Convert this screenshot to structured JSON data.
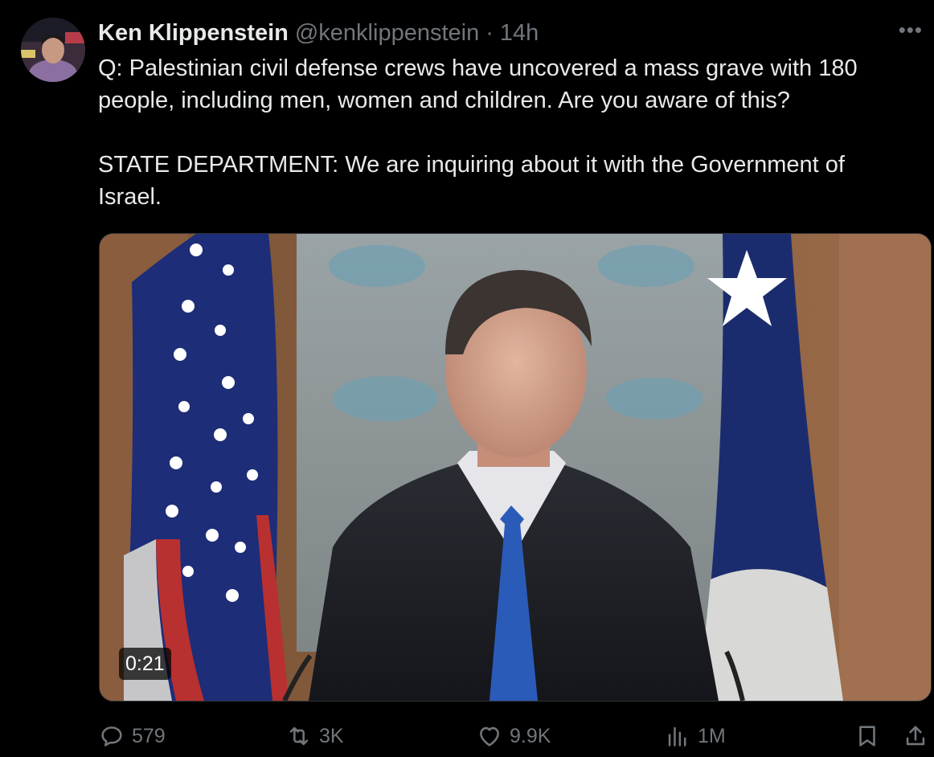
{
  "author": {
    "name": "Ken Klippenstein",
    "handle": "@kenklippenstein",
    "separator": "·",
    "time": "14h"
  },
  "post": {
    "text": "Q: Palestinian civil defense crews have uncovered a mass grave with 180 people, including men, women and children. Are you aware of this?\n\nSTATE DEPARTMENT: We are inquiring about it with the Government of Israel."
  },
  "media": {
    "type": "video",
    "duration": "0:21"
  },
  "actions": {
    "replies": "579",
    "reposts": "3K",
    "likes": "9.9K",
    "views": "1M"
  },
  "icons": {
    "more": "more-horizontal-icon",
    "reply": "reply-icon",
    "repost": "repost-icon",
    "like": "heart-icon",
    "views": "views-icon",
    "bookmark": "bookmark-icon",
    "share": "share-icon"
  },
  "colors": {
    "background": "#000000",
    "text": "#e7e9ea",
    "secondary": "#71767b"
  }
}
